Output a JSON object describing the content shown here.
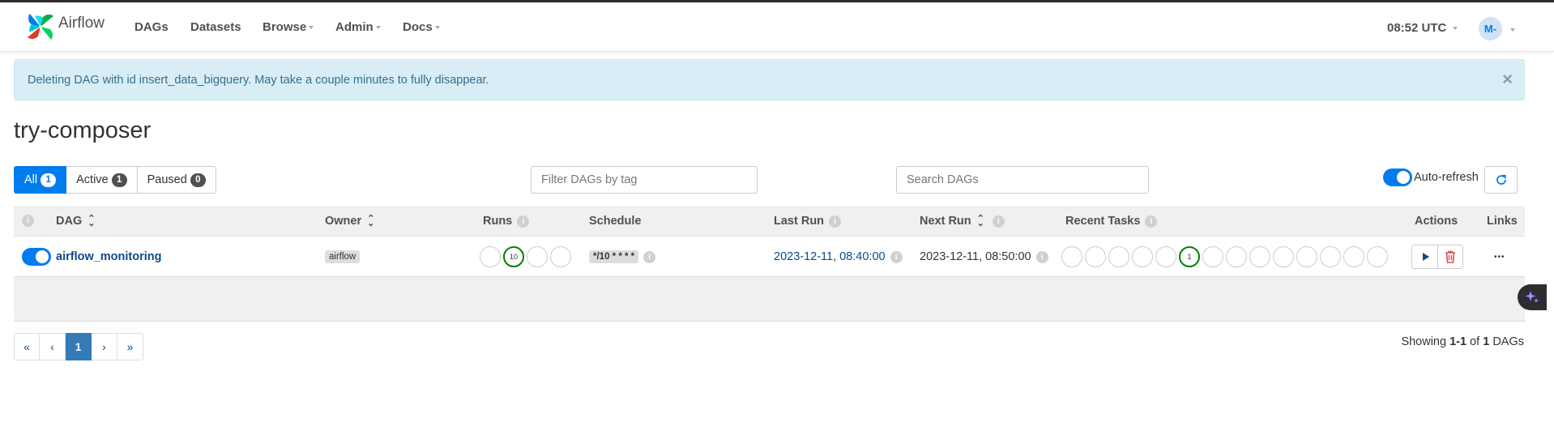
{
  "navbar": {
    "brand": "Airflow",
    "items": [
      {
        "label": "DAGs",
        "dropdown": false
      },
      {
        "label": "Datasets",
        "dropdown": false
      },
      {
        "label": "Browse",
        "dropdown": true
      },
      {
        "label": "Admin",
        "dropdown": true
      },
      {
        "label": "Docs",
        "dropdown": true
      }
    ],
    "clock": "08:52 UTC",
    "avatar_initials": "M-"
  },
  "alert": {
    "message": "Deleting DAG with id insert_data_bigquery. May take a couple minutes to fully disappear.",
    "close": "×"
  },
  "page_title": "try-composer",
  "filters": {
    "all": {
      "label": "All",
      "count": "1"
    },
    "active": {
      "label": "Active",
      "count": "1"
    },
    "paused": {
      "label": "Paused",
      "count": "0"
    }
  },
  "tag_filter": {
    "placeholder": "Filter DAGs by tag"
  },
  "search": {
    "placeholder": "Search DAGs"
  },
  "auto_refresh": {
    "label": "Auto-refresh",
    "enabled": true
  },
  "table": {
    "headers": {
      "dag": "DAG",
      "owner": "Owner",
      "runs": "Runs",
      "schedule": "Schedule",
      "last_run": "Last Run",
      "next_run": "Next Run",
      "recent_tasks": "Recent Tasks",
      "actions": "Actions",
      "links": "Links"
    },
    "rows": [
      {
        "dag_id": "airflow_monitoring",
        "paused": false,
        "owner": "airflow",
        "runs_success": "10",
        "schedule": "*/10 * * * *",
        "last_run": "2023-12-11, 08:40:00",
        "next_run": "2023-12-11, 08:50:00",
        "recent_tasks_success": "1",
        "links_label": "•••"
      }
    ]
  },
  "pagination": {
    "first": "«",
    "prev": "‹",
    "current": "1",
    "next": "›",
    "last": "»"
  },
  "showing": {
    "prefix": "Showing",
    "range": "1-1",
    "of": "of",
    "total": "1",
    "suffix": "DAGs"
  },
  "colors": {
    "accent": "#017cee",
    "success": "#008000",
    "alert_bg": "#d9edf7",
    "alert_text": "#31708f",
    "delete": "#d9534f"
  }
}
